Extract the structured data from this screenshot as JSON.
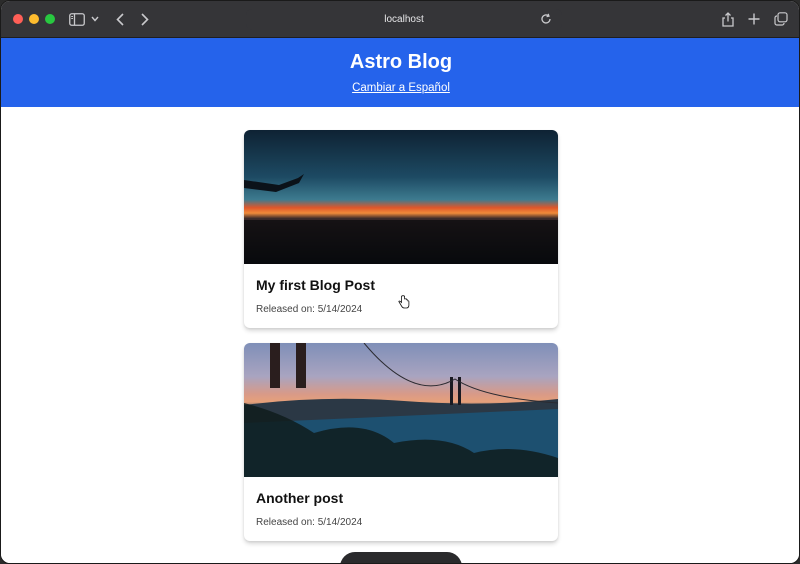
{
  "browser": {
    "url": "localhost",
    "icons": {
      "sidebar": "sidebar-icon",
      "sidebar_menu": "chevron-down-icon",
      "back": "chevron-left-icon",
      "forward": "chevron-right-icon",
      "reload": "reload-icon",
      "share": "share-icon",
      "new_tab": "plus-icon",
      "tab_overview": "tabs-icon"
    },
    "colors": {
      "toolbar": "#353538"
    }
  },
  "header": {
    "title": "Astro Blog",
    "language_link": "Cambiar a Español",
    "background": "#2563eb"
  },
  "posts": [
    {
      "title": "My first Blog Post",
      "date": "Released on: 5/14/2024",
      "image": "sunset over horizon from airplane window"
    },
    {
      "title": "Another post",
      "date": "Released on: 5/14/2024",
      "image": "golden gate bridge at dusk"
    }
  ]
}
